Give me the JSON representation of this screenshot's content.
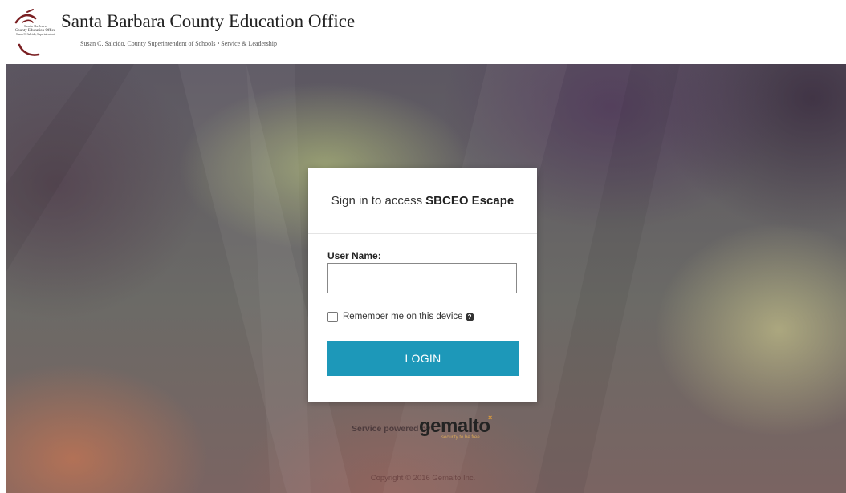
{
  "header": {
    "logo_line1": "Santa Barbara",
    "logo_line2": "County Education Office",
    "logo_line3": "Susan C. Salcido, Superintendent",
    "title": "Santa Barbara County Education Office",
    "subtitle": "Susan C. Salcido, County Superintendent of Schools   •   Service & Leadership"
  },
  "login_card": {
    "heading_prefix": "Sign in to access",
    "heading_app": "SBCEO Escape",
    "username_label": "User Name:",
    "username_value": "",
    "remember_label": "Remember me on this device",
    "remember_checked": false,
    "help_icon": "question-circle-icon",
    "login_label": "LOGIN"
  },
  "footer": {
    "powered_by": "Service powered by",
    "brand": "gemalto",
    "brand_tagline": "security to be free",
    "brand_mark": "×",
    "copyright": "Copyright © 2016 Gemalto Inc."
  },
  "colors": {
    "login_button": "#1d98b9",
    "logo_accent": "#7a1f22"
  }
}
